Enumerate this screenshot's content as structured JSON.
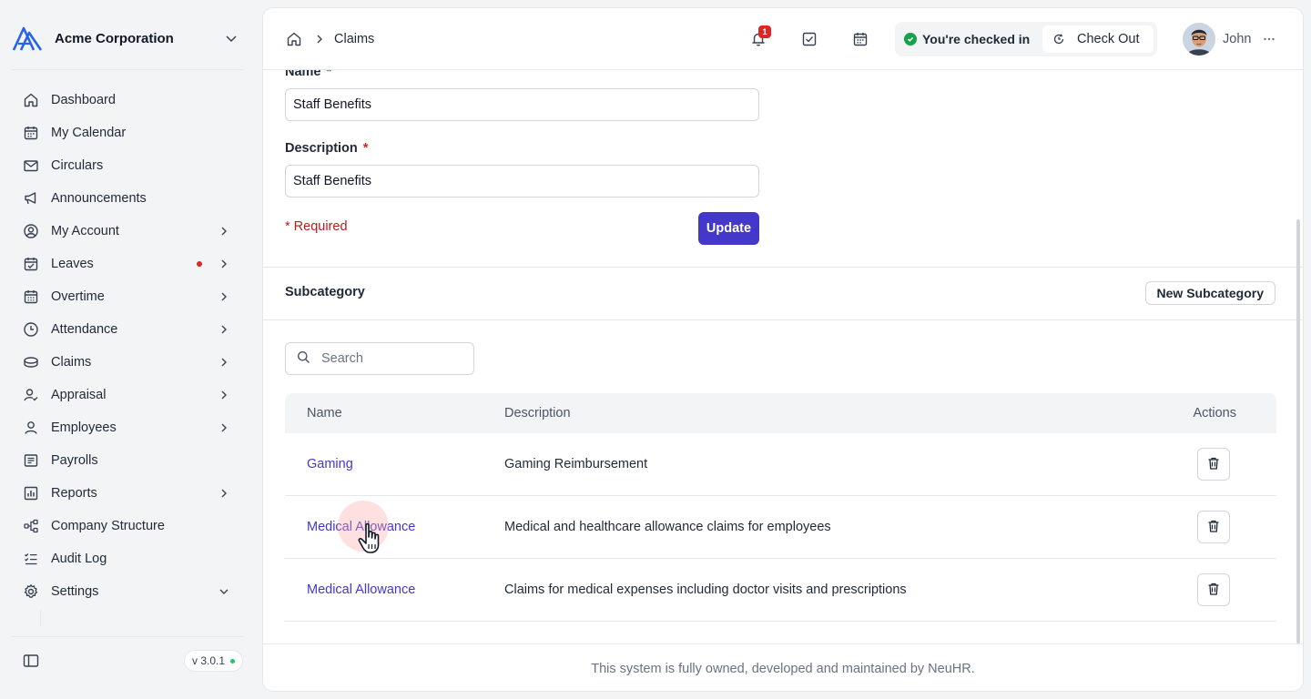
{
  "sidebar": {
    "org_name": "Acme Corporation",
    "items": [
      {
        "label": "Dashboard",
        "icon": "home-icon"
      },
      {
        "label": "My Calendar",
        "icon": "calendar-icon"
      },
      {
        "label": "Circulars",
        "icon": "mail-icon"
      },
      {
        "label": "Announcements",
        "icon": "megaphone-icon"
      },
      {
        "label": "My Account",
        "icon": "user-circle-icon",
        "expandable": true
      },
      {
        "label": "Leaves",
        "icon": "calendar-check-icon",
        "expandable": true,
        "badge_dot": true
      },
      {
        "label": "Overtime",
        "icon": "calendar-grid-icon",
        "expandable": true
      },
      {
        "label": "Attendance",
        "icon": "clock-icon",
        "expandable": true
      },
      {
        "label": "Claims",
        "icon": "coins-icon",
        "expandable": true
      },
      {
        "label": "Appraisal",
        "icon": "user-check-icon",
        "expandable": true
      },
      {
        "label": "Employees",
        "icon": "user-icon",
        "expandable": true
      },
      {
        "label": "Payrolls",
        "icon": "receipt-icon"
      },
      {
        "label": "Reports",
        "icon": "chart-icon",
        "expandable": true
      },
      {
        "label": "Company Structure",
        "icon": "hierarchy-icon"
      },
      {
        "label": "Audit Log",
        "icon": "checklist-icon"
      },
      {
        "label": "Settings",
        "icon": "gear-icon",
        "expandable": true,
        "expanded": true
      }
    ],
    "version": "v 3.0.1"
  },
  "topbar": {
    "breadcrumb": "Claims",
    "notification_count": "1",
    "checked_in_text": "You're checked in",
    "check_out_label": "Check Out",
    "user_name": "John"
  },
  "form": {
    "name_label": "Name",
    "name_value": "Staff Benefits",
    "description_label": "Description",
    "description_value": "Staff Benefits",
    "required_asterisk": "*",
    "required_note": "* Required",
    "update_label": "Update"
  },
  "subcategory": {
    "title": "Subcategory",
    "new_button": "New Subcategory",
    "search_placeholder": "Search",
    "columns": {
      "name": "Name",
      "description": "Description",
      "actions": "Actions"
    },
    "rows": [
      {
        "name": "Gaming",
        "description": "Gaming Reimbursement"
      },
      {
        "name": "Medical Allowance",
        "description": "Medical and healthcare allowance claims for employees"
      },
      {
        "name": "Medical Allowance",
        "description": "Claims for medical expenses including doctor visits and prescriptions"
      }
    ]
  },
  "footer": {
    "text": "This system is fully owned, developed and maintained by NeuHR."
  },
  "colors": {
    "accent": "#4338ca",
    "danger": "#dc2626",
    "success": "#16a34a"
  }
}
